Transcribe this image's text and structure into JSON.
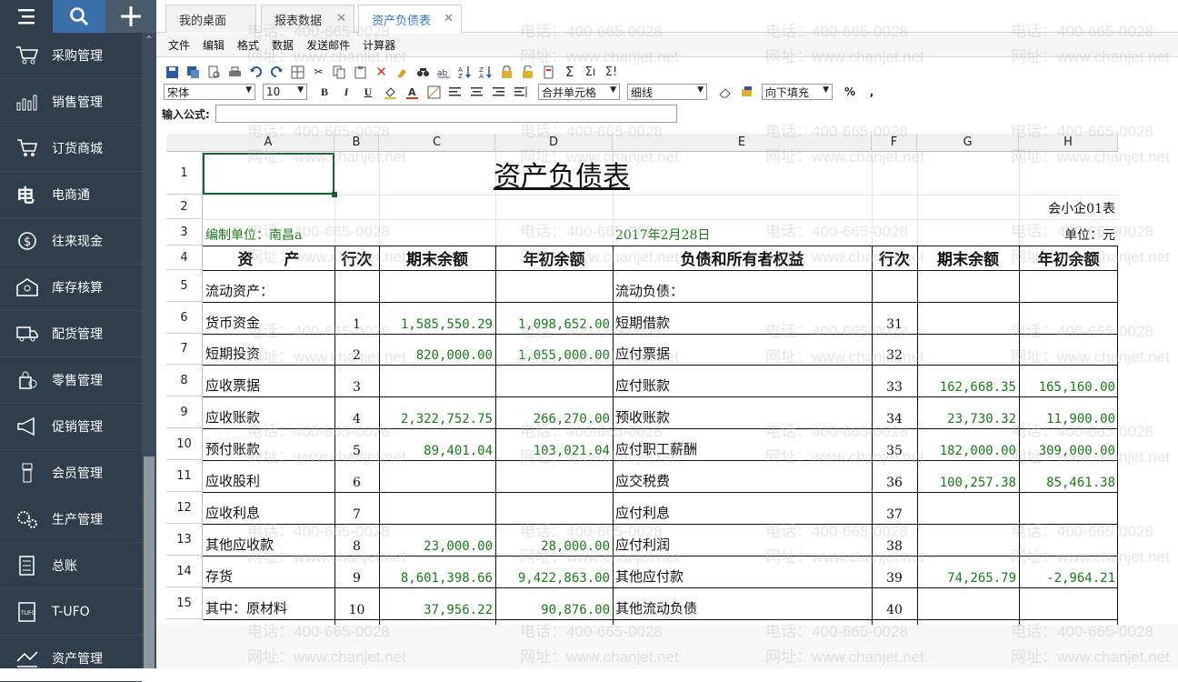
{
  "sidebar": {
    "items": [
      {
        "label": "采购管理",
        "icon": "shopping-cart-icon"
      },
      {
        "label": "销售管理",
        "icon": "bar-chart-icon"
      },
      {
        "label": "订货商城",
        "icon": "cart-icon"
      },
      {
        "label": "电商通",
        "icon": "ecommerce-icon"
      },
      {
        "label": "往来现金",
        "icon": "dollar-icon"
      },
      {
        "label": "库存核算",
        "icon": "warehouse-icon"
      },
      {
        "label": "配货管理",
        "icon": "truck-icon"
      },
      {
        "label": "零售管理",
        "icon": "retail-icon"
      },
      {
        "label": "促销管理",
        "icon": "megaphone-icon"
      },
      {
        "label": "会员管理",
        "icon": "member-icon"
      },
      {
        "label": "生产管理",
        "icon": "gears-icon"
      },
      {
        "label": "总账",
        "icon": "ledger-icon"
      },
      {
        "label": "T-UFO",
        "icon": "tufo-icon"
      },
      {
        "label": "资产管理",
        "icon": "asset-icon"
      }
    ]
  },
  "tabs": [
    {
      "label": "我的桌面",
      "closable": false
    },
    {
      "label": "报表数据",
      "closable": true
    },
    {
      "label": "资产负债表",
      "closable": true
    }
  ],
  "menu": [
    "文件",
    "编辑",
    "格式",
    "数据",
    "发送邮件",
    "计算器"
  ],
  "toolbar": {
    "font": "宋体",
    "size": "10",
    "merge": "合并单元格",
    "border": "细线",
    "fill": "向下填充",
    "bold": "B",
    "italic": "I",
    "underline": "U",
    "percent": "%",
    "comma": ","
  },
  "formula": {
    "label": "输入公式:"
  },
  "sheet": {
    "columns": [
      "A",
      "B",
      "C",
      "D",
      "E",
      "F",
      "G",
      "H"
    ],
    "rows": [
      "1",
      "2",
      "3",
      "4",
      "5",
      "6",
      "7",
      "8",
      "9",
      "10",
      "11",
      "12",
      "13",
      "14",
      "15"
    ],
    "title": "资产负债表",
    "form_no": "会小企01表",
    "org": "编制单位：南昌a",
    "date": "2017年2月28日",
    "unit": "单位：元",
    "headers": [
      "资　　产",
      "行次",
      "期末余额",
      "年初余额",
      "负债和所有者权益",
      "行次",
      "期末余额",
      "年初余额"
    ],
    "body": [
      [
        "流动资产：",
        "",
        "",
        "",
        "流动负债：",
        "",
        "",
        ""
      ],
      [
        "货币资金",
        "1",
        "1,585,550.29",
        "1,098,652.00",
        "短期借款",
        "31",
        "",
        ""
      ],
      [
        "短期投资",
        "2",
        "820,000.00",
        "1,055,000.00",
        "应付票据",
        "32",
        "",
        ""
      ],
      [
        "应收票据",
        "3",
        "",
        "",
        "应付账款",
        "33",
        "162,668.35",
        "165,160.00"
      ],
      [
        "应收账款",
        "4",
        "2,322,752.75",
        "266,270.00",
        "预收账款",
        "34",
        "23,730.32",
        "11,900.00"
      ],
      [
        "预付账款",
        "5",
        "89,401.04",
        "103,021.04",
        "应付职工薪酬",
        "35",
        "182,000.00",
        "309,000.00"
      ],
      [
        "应收股利",
        "6",
        "",
        "",
        "应交税费",
        "36",
        "100,257.38",
        "85,461.38"
      ],
      [
        "应收利息",
        "7",
        "",
        "",
        "应付利息",
        "37",
        "",
        ""
      ],
      [
        "其他应收款",
        "8",
        "23,000.00",
        "28,000.00",
        "应付利润",
        "38",
        "",
        ""
      ],
      [
        "存货",
        "9",
        "8,601,398.66",
        "9,422,863.00",
        "其他应付款",
        "39",
        "74,265.79",
        "-2,964.21"
      ],
      [
        "其中：原材料",
        "10",
        "37,956.22",
        "90,876.00",
        "其他流动负债",
        "40",
        "",
        ""
      ]
    ]
  },
  "watermark": {
    "phone": "电话：400-665-0028",
    "site": "网址：www.chanjet.net"
  }
}
